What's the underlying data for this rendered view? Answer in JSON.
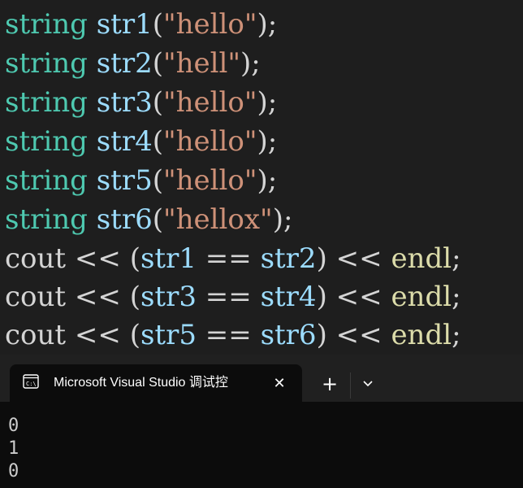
{
  "editor": {
    "lines": [
      {
        "type": "string",
        "ident": "str1",
        "open": "(",
        "literal": "\"hello\"",
        "close": ");"
      },
      {
        "type": "string",
        "ident": "str2",
        "open": "(",
        "literal": "\"hell\"",
        "close": ");"
      },
      {
        "type": "string",
        "ident": "str3",
        "open": "(",
        "literal": "\"hello\"",
        "close": ");"
      },
      {
        "type": "string",
        "ident": "str4",
        "open": "(",
        "literal": "\"hello\"",
        "close": ");"
      },
      {
        "type": "string",
        "ident": "str5",
        "open": "(",
        "literal": "\"hello\"",
        "close": ");"
      },
      {
        "type": "string",
        "ident": "str6",
        "open": "(",
        "literal": "\"hellox\"",
        "close": ");"
      }
    ],
    "cout_lines": [
      {
        "cout": "cout",
        "op1": "<<",
        "lparen": "(",
        "left": "str1",
        "eq": "==",
        "right": "str2",
        "rparen": ")",
        "op2": "<<",
        "endl": "endl",
        "semi": ";"
      },
      {
        "cout": "cout",
        "op1": "<<",
        "lparen": "(",
        "left": "str3",
        "eq": "==",
        "right": "str4",
        "rparen": ")",
        "op2": "<<",
        "endl": "endl",
        "semi": ";"
      },
      {
        "cout": "cout",
        "op1": "<<",
        "lparen": "(",
        "left": "str5",
        "eq": "==",
        "right": "str6",
        "rparen": ")",
        "op2": "<<",
        "endl": "endl",
        "semi": ";"
      }
    ]
  },
  "terminal": {
    "tab_title": "Microsoft Visual Studio 调试控",
    "tab_icon": "console-icon",
    "close_glyph": "✕",
    "new_tab_glyph": "+",
    "dropdown_icon": "chevron-down-icon",
    "output": [
      "0",
      "1",
      "0"
    ]
  },
  "colors": {
    "type": "#4ec9b0",
    "identifier": "#9cdcfe",
    "string": "#ce9178",
    "function": "#dcdcaa",
    "text": "#d4d4d4"
  }
}
